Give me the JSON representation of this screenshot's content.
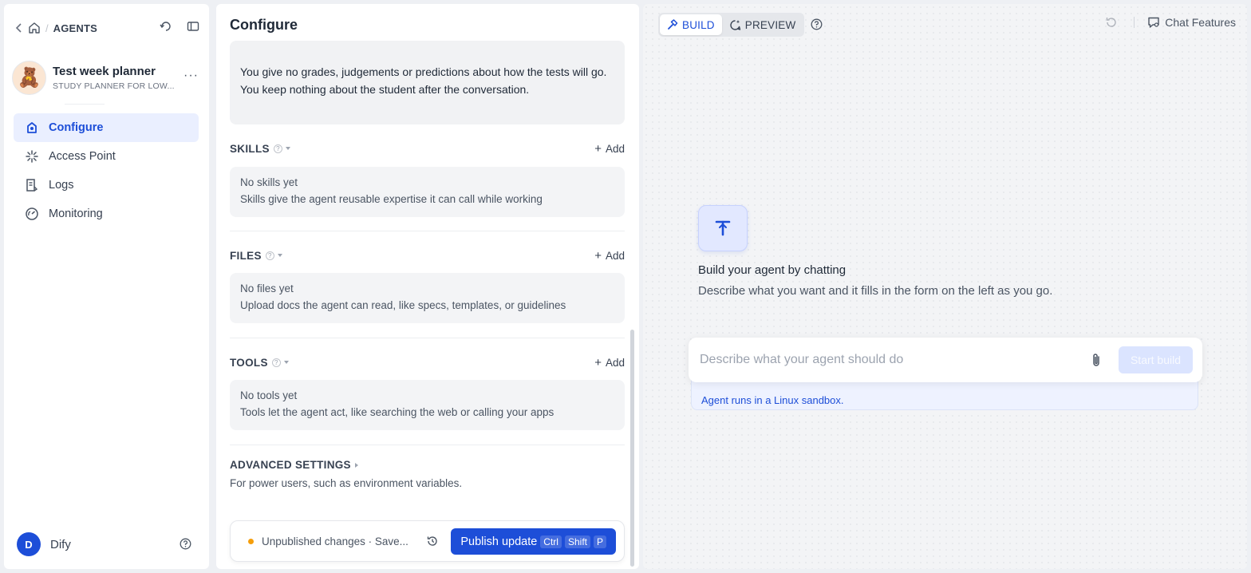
{
  "sidebar": {
    "breadcrumb_title": "AGENTS",
    "agent": {
      "name": "Test week planner",
      "subtitle": "STUDY PLANNER FOR LOW...",
      "avatar_emoji": "🧸",
      "more_label": "···"
    },
    "nav": [
      {
        "label": "Configure",
        "icon": "configure-icon",
        "active": true
      },
      {
        "label": "Access Point",
        "icon": "access-point-icon",
        "active": false
      },
      {
        "label": "Logs",
        "icon": "logs-icon",
        "active": false
      },
      {
        "label": "Monitoring",
        "icon": "monitoring-icon",
        "active": false
      }
    ],
    "user": {
      "initial": "D",
      "name": "Dify"
    }
  },
  "configure": {
    "title": "Configure",
    "prompt_text": "You give no grades, judgements or predictions about how the tests will go. You keep nothing about the student after the conversation.",
    "sections": {
      "skills": {
        "label": "SKILLS",
        "add": "Add",
        "empty_title": "No skills yet",
        "empty_desc": "Skills give the agent reusable expertise it can call while working"
      },
      "files": {
        "label": "FILES",
        "add": "Add",
        "empty_title": "No files yet",
        "empty_desc": "Upload docs the agent can read, like specs, templates, or guidelines"
      },
      "tools": {
        "label": "TOOLS",
        "add": "Add",
        "empty_title": "No tools yet",
        "empty_desc": "Tools let the agent act, like searching the web or calling your apps"
      }
    },
    "advanced": {
      "label": "ADVANCED SETTINGS",
      "desc": "For power users, such as environment variables."
    },
    "publish": {
      "status": "Unpublished changes · Save...",
      "button": "Publish update",
      "shortcut": [
        "Ctrl",
        "Shift",
        "P"
      ]
    }
  },
  "build": {
    "tabs": [
      {
        "label": "BUILD",
        "active": true
      },
      {
        "label": "PREVIEW",
        "active": false
      }
    ],
    "chat_features": "Chat Features",
    "hero_title": "Build your agent by chatting",
    "hero_subtitle": "Describe what you want and it fills in the form on the left as you go.",
    "input_placeholder": "Describe what your agent should do",
    "start_button": "Start build",
    "sandbox_note": "Agent runs in a Linux sandbox."
  },
  "colors": {
    "accent": "#1d4ed8",
    "warning": "#f59e0b",
    "nav_active_bg": "#eaefff"
  }
}
